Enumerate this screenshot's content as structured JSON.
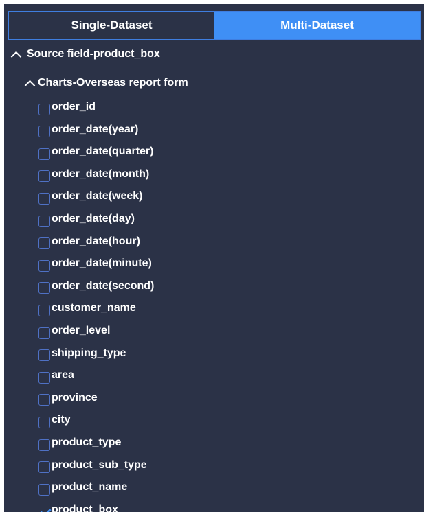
{
  "tabs": [
    {
      "label": "Single-Dataset",
      "active": false
    },
    {
      "label": "Multi-Dataset",
      "active": true
    }
  ],
  "tree": {
    "root_label": "Source field-product_box",
    "group_label": "Charts-Overseas report form",
    "fields": [
      {
        "label": "order_id",
        "checked": false
      },
      {
        "label": "order_date(year)",
        "checked": false
      },
      {
        "label": "order_date(quarter)",
        "checked": false
      },
      {
        "label": "order_date(month)",
        "checked": false
      },
      {
        "label": "order_date(week)",
        "checked": false
      },
      {
        "label": "order_date(day)",
        "checked": false
      },
      {
        "label": "order_date(hour)",
        "checked": false
      },
      {
        "label": "order_date(minute)",
        "checked": false
      },
      {
        "label": "order_date(second)",
        "checked": false
      },
      {
        "label": "customer_name",
        "checked": false
      },
      {
        "label": "order_level",
        "checked": false
      },
      {
        "label": "shipping_type",
        "checked": false
      },
      {
        "label": "area",
        "checked": false
      },
      {
        "label": "province",
        "checked": false
      },
      {
        "label": "city",
        "checked": false
      },
      {
        "label": "product_type",
        "checked": false
      },
      {
        "label": "product_sub_type",
        "checked": false
      },
      {
        "label": "product_name",
        "checked": false
      },
      {
        "label": "product_box",
        "checked": true
      }
    ]
  },
  "colors": {
    "panel_bg": "#2b3247",
    "accent": "#3f8ff5",
    "checkbox_border": "#4f71c5"
  }
}
